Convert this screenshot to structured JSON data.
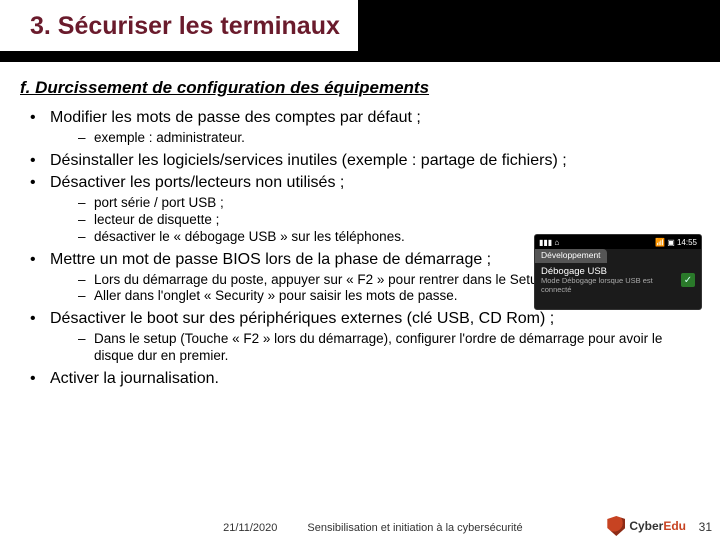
{
  "slide": {
    "title": "3. Sécuriser les terminaux",
    "subhead": "f. Durcissement de configuration des équipements"
  },
  "bullets": {
    "b1": "Modifier les mots de passe des comptes par défaut ;",
    "b1s1": "exemple : administrateur.",
    "b2": "Désinstaller les logiciels/services inutiles (exemple : partage de fichiers) ;",
    "b3": "Désactiver les ports/lecteurs non utilisés ;",
    "b3s1": "port série / port USB ;",
    "b3s2": "lecteur de disquette ;",
    "b3s3": "désactiver le « débogage USB » sur les téléphones.",
    "b4": "Mettre un mot de passe BIOS lors de la phase de démarrage ;",
    "b4s1": "Lors du démarrage du poste, appuyer sur « F2 » pour rentrer dans le Setup ;",
    "b4s2": "Aller dans l'onglet « Security » pour saisir les mots de passe.",
    "b5": "Désactiver le boot sur des périphériques externes (clé USB, CD Rom) ;",
    "b5s1": "Dans le setup (Touche « F2 » lors du démarrage), configurer l'ordre de démarrage pour avoir le disque dur en premier.",
    "b6": "Activer la journalisation."
  },
  "phone": {
    "status_left": "▮▮▮ ⌂",
    "status_right": "📶 ▣ 14:55",
    "tab": "Développement",
    "row_title": "Débogage USB",
    "row_sub": "Mode Débogage lorsque USB est connecté",
    "check": "✓"
  },
  "footer": {
    "date": "21/11/2020",
    "caption": "Sensibilisation et initiation à la cybersécurité",
    "logo_cyber": "Cyber",
    "logo_edu": "Edu",
    "page": "31"
  }
}
